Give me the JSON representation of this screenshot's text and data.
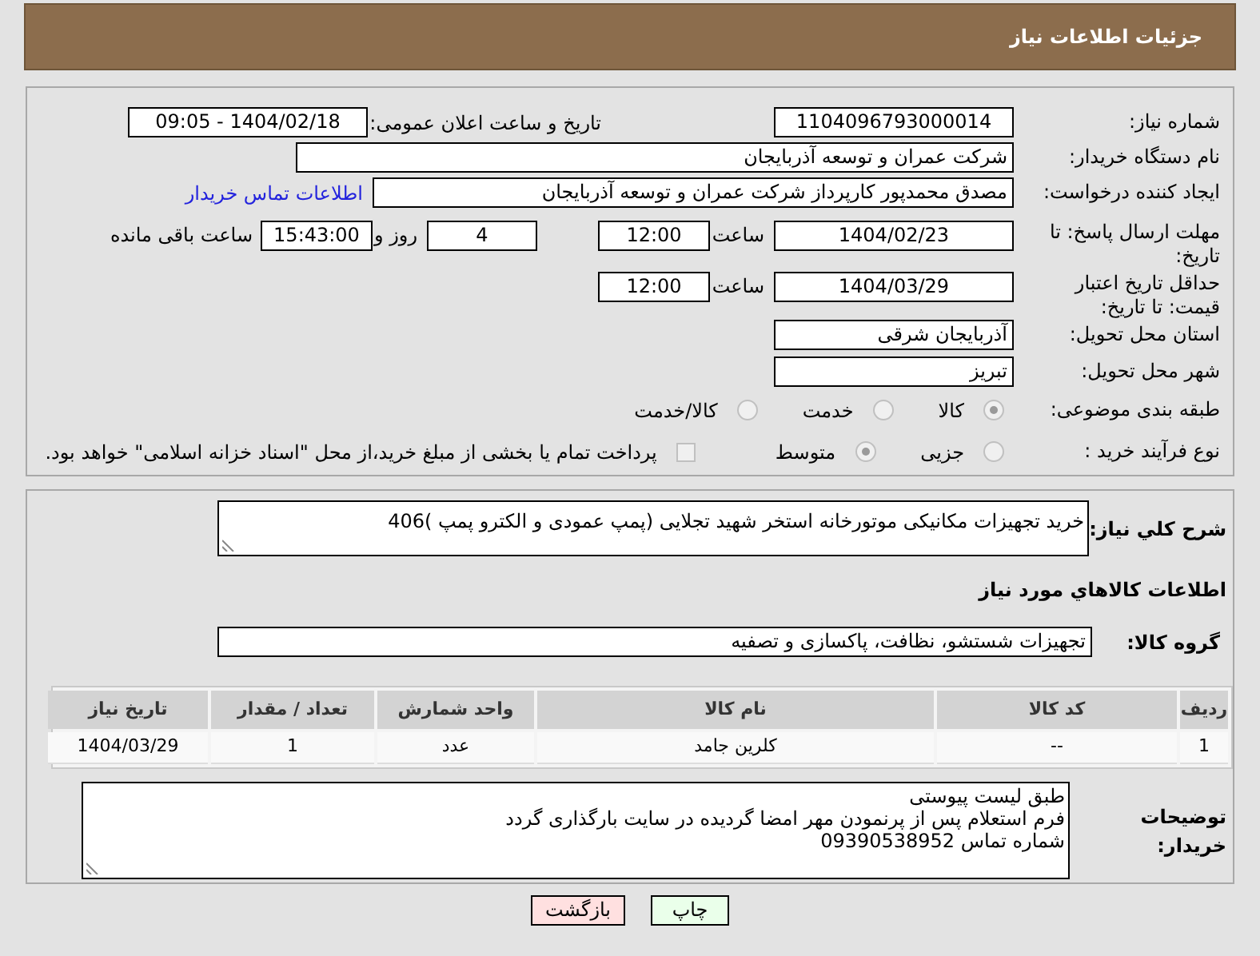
{
  "header": {
    "title": "جزئیات اطلاعات نیاز"
  },
  "need_number": {
    "label": "شماره نیاز:",
    "value": "1104096793000014"
  },
  "announce": {
    "label": "تاریخ و ساعت اعلان عمومی:",
    "value": "1404/02/18 - 09:05"
  },
  "buyer_org": {
    "label": "نام دستگاه خریدار:",
    "value": "شرکت عمران و توسعه آذربایجان"
  },
  "requester": {
    "label": "ایجاد کننده درخواست:",
    "value": "مصدق محمدپور کارپرداز شرکت عمران و توسعه آذربایجان",
    "link": "اطلاعات تماس خریدار"
  },
  "reply_deadline": {
    "label": "مهلت ارسال پاسخ: تا تاریخ:",
    "date": "1404/02/23",
    "time_label": "ساعت",
    "time": "12:00",
    "days": "4",
    "days_label": "روز و",
    "remaining": "15:43:00",
    "remaining_label": "ساعت باقی مانده"
  },
  "price_validity": {
    "label": "حداقل تاریخ اعتبار قیمت: تا تاریخ:",
    "date": "1404/03/29",
    "time_label": "ساعت",
    "time": "12:00"
  },
  "province": {
    "label": "استان محل تحویل:",
    "value": "آذربایجان شرقی"
  },
  "city": {
    "label": "شهر محل تحویل:",
    "value": "تبریز"
  },
  "category": {
    "label": "طبقه بندی موضوعی:",
    "options": [
      {
        "label": "کالا",
        "selected": true
      },
      {
        "label": "خدمت",
        "selected": false
      },
      {
        "label": "کالا/خدمت",
        "selected": false
      }
    ]
  },
  "process": {
    "label": "نوع فرآیند خرید :",
    "options": [
      {
        "label": "جزیی",
        "selected": false
      },
      {
        "label": "متوسط",
        "selected": true
      }
    ],
    "payment_note": {
      "label": "پرداخت تمام یا بخشی از مبلغ خرید،از محل \"اسناد خزانه اسلامی\" خواهد بود.",
      "checked": false
    }
  },
  "description": {
    "label": "شرح کلي نياز:",
    "value": "خرید تجهیزات مکانیکی موتورخانه استخر شهید تجلایی (پمپ عمودی و الکترو پمپ )406"
  },
  "goods_title": "اطلاعات كالاهاي مورد نياز",
  "goods_group": {
    "label": "گروه کالا:",
    "value": "تجهیزات شستشو، نظافت، پاکسازی و تصفیه"
  },
  "table": {
    "columns": [
      "رديف",
      "کد کالا",
      "نام کالا",
      "واحد شمارش",
      "تعداد / مقدار",
      "تاریخ نیاز"
    ],
    "rows": [
      [
        "1",
        "--",
        "کلرین جامد",
        "عدد",
        "1",
        "1404/03/29"
      ]
    ]
  },
  "buyer_notes": {
    "label": "توضیحات خریدار:",
    "lines": [
      "طبق لیست پیوستی",
      "فرم استعلام پس از پرنمودن مهر امضا گردیده در سایت بارگذاری گردد",
      "شماره تماس 09390538952"
    ]
  },
  "buttons": [
    {
      "label": "چاپ",
      "kind": "print"
    },
    {
      "label": "بازگشت",
      "kind": "back"
    }
  ]
}
